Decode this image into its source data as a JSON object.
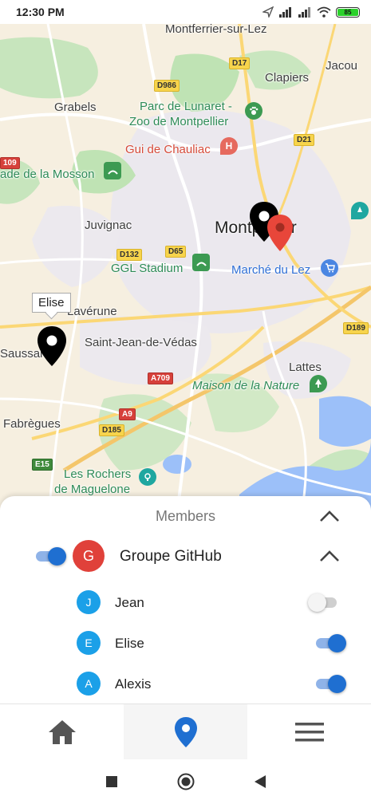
{
  "status_bar": {
    "time": "12:30 PM",
    "battery": "85",
    "icons": [
      "navigation-arrow-icon",
      "signal-icon",
      "signal-icon",
      "wifi-icon",
      "battery-icon"
    ]
  },
  "map": {
    "labels": {
      "montferrier": "Montferrier-sur-Lez",
      "jacou": "Jacou",
      "clapiers": "Clapiers",
      "grabels": "Grabels",
      "lunaret": "Parc de Lunaret -",
      "lunaret2": "Zoo de Montpellier",
      "chauliac": "Gui de Chauliac",
      "mosson": "ade de la Mosson",
      "juvignac": "Juvignac",
      "montpellier": "Montpellier",
      "stadium": "GGL Stadium",
      "marche": "Marché du Lez",
      "laverune": "Lavérune",
      "saussan": "Saussan",
      "vedas": "Saint-Jean-de-Védas",
      "lattes": "Lattes",
      "maison_nature": "Maison de la Nature",
      "fabregues": "Fabrègues",
      "rochers": "Les Rochers",
      "maguelone": "de Maguelone"
    },
    "roads": {
      "d17": "D17",
      "d986": "D986",
      "d21": "D21",
      "d109": "109",
      "d132": "D132",
      "d65": "D65",
      "d189": "D189",
      "a709": "A709",
      "a9": "A9",
      "d185": "D185",
      "e15": "E15"
    },
    "tooltip": "Elise",
    "colors": {
      "marker_black": "#000000",
      "marker_red": "#e8463a",
      "water": "#9cc0f9",
      "park": "#b9e0b0"
    }
  },
  "sheet": {
    "title": "Members",
    "group": {
      "avatar_letter": "G",
      "name": "Groupe GitHub",
      "enabled": true
    },
    "members": [
      {
        "initial": "J",
        "name": "Jean",
        "enabled": false
      },
      {
        "initial": "E",
        "name": "Elise",
        "enabled": true
      },
      {
        "initial": "A",
        "name": "Alexis",
        "enabled": true
      }
    ]
  },
  "bottom_nav": {
    "items": [
      "home-icon",
      "location-pin-icon",
      "menu-icon"
    ],
    "active": "location-pin-icon",
    "accent": "#1f6fd1"
  },
  "system_nav": [
    "recents-square-icon",
    "home-circle-icon",
    "back-triangle-icon"
  ]
}
